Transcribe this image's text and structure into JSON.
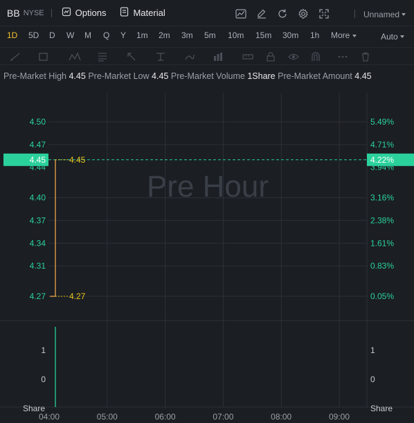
{
  "toolbar": {
    "symbol": "BB",
    "exchange": "NYSE",
    "options_label": "Options",
    "material_label": "Material",
    "tools": [
      "chart-type-icon",
      "draw-pen-icon",
      "refresh-icon",
      "settings-gear-icon",
      "fullscreen-icon"
    ],
    "layout_label": "Unnamed"
  },
  "periods": {
    "items": [
      "1D",
      "5D",
      "D",
      "W",
      "M",
      "Q",
      "Y",
      "1m",
      "2m",
      "3m",
      "5m",
      "10m",
      "15m",
      "30m",
      "1h",
      "More"
    ],
    "active": "1D",
    "scale_label": "Auto"
  },
  "drawing_tools": [
    "trendline-icon",
    "rectangle-icon",
    "pattern-icon",
    "fibonacci-icon",
    "arrow-icon",
    "measure-icon",
    "indicator-icon",
    "lock-icon",
    "eye-icon",
    "magnet-icon",
    "trash-icon"
  ],
  "info": {
    "high_label": "Pre-Market High",
    "high_value": "4.45",
    "low_label": "Pre-Market Low",
    "low_value": "4.45",
    "volume_label": "Pre-Market Volume",
    "volume_value": "1Share",
    "amount_label": "Pre-Market Amount",
    "amount_value": "4.45"
  },
  "colors": {
    "background": "#1b1e23",
    "grid": "#2c3138",
    "up_green": "#2bd19b",
    "price_line": "#f0a64a",
    "label_yellow": "#e8c41c",
    "watermark": "#3a3f47"
  },
  "chart_data": {
    "type": "line",
    "watermark": "Pre Hour",
    "x_ticks": [
      "04:00",
      "05:00",
      "06:00",
      "07:00",
      "08:00",
      "09:00"
    ],
    "y_ticks": [
      "4.50",
      "4.47",
      "4.44",
      "4.40",
      "4.37",
      "4.34",
      "4.31",
      "4.27"
    ],
    "y_ticks_values": [
      4.5,
      4.47,
      4.44,
      4.4,
      4.37,
      4.34,
      4.31,
      4.27
    ],
    "pct_ticks": [
      "5.49%",
      "4.71%",
      "3.94%",
      "3.16%",
      "2.38%",
      "1.61%",
      "0.83%",
      "0.05%"
    ],
    "ylim": [
      4.27,
      4.5
    ],
    "current_price": "4.45",
    "current_pct": "4.22%",
    "current_value": 4.45,
    "series": [
      {
        "x": [
          "04:00",
          "04:00"
        ],
        "values": [
          4.27,
          4.45
        ]
      }
    ],
    "annotations": [
      {
        "label": "4.45",
        "value": 4.45
      },
      {
        "label": "4.27",
        "value": 4.27
      }
    ],
    "volume": {
      "label": "Share",
      "y_ticks": [
        "1",
        "0"
      ],
      "values": [
        1
      ]
    }
  }
}
